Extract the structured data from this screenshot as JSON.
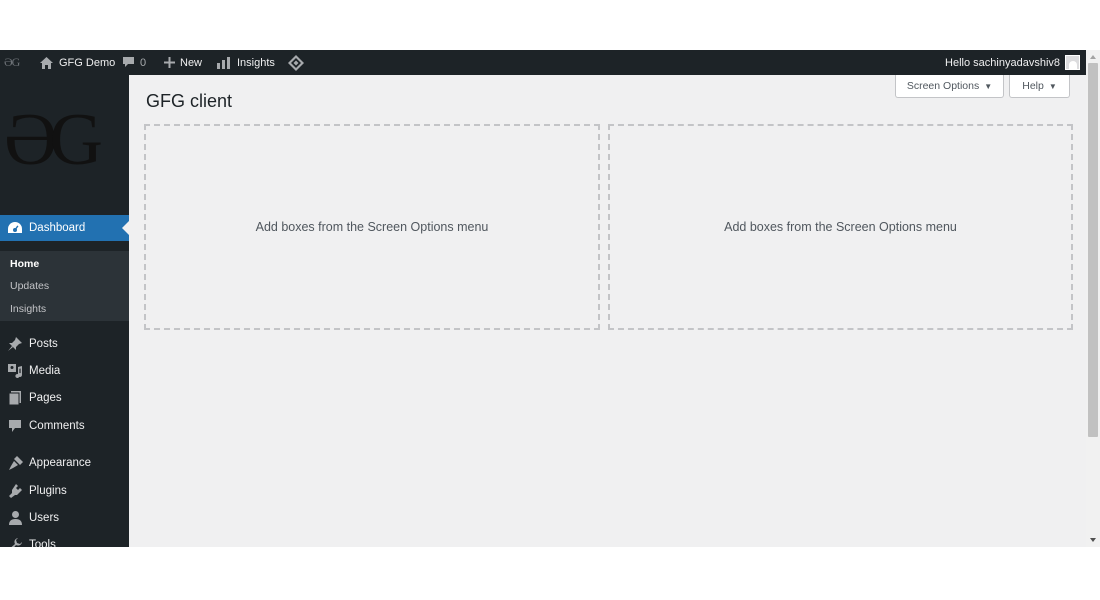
{
  "admin_bar": {
    "logo_text": "ƏG",
    "site_name": "GFG Demo",
    "comments_count": "0",
    "new_label": "New",
    "insights_label": "Insights",
    "account_greeting": "Hello sachinyadavshiv8"
  },
  "sidebar": {
    "logo_text": "ƏG",
    "current_menu": {
      "label": "Dashboard",
      "icon": "dashboard-icon"
    },
    "submenu": [
      {
        "label": "Home",
        "active": true
      },
      {
        "label": "Updates",
        "active": false
      },
      {
        "label": "Insights",
        "active": false
      }
    ],
    "menu_items": [
      {
        "label": "Posts",
        "icon": "pin-icon"
      },
      {
        "label": "Media",
        "icon": "media-icon"
      },
      {
        "label": "Pages",
        "icon": "pages-icon"
      },
      {
        "label": "Comments",
        "icon": "comments-icon"
      },
      {
        "label": "Appearance",
        "icon": "appearance-icon"
      },
      {
        "label": "Plugins",
        "icon": "plugins-icon"
      },
      {
        "label": "Users",
        "icon": "users-icon"
      },
      {
        "label": "Tools",
        "icon": "tools-icon"
      }
    ]
  },
  "main": {
    "page_title": "GFG client",
    "screen_options_label": "Screen Options",
    "help_label": "Help",
    "boxes": [
      {
        "placeholder": "Add boxes from the Screen Options menu"
      },
      {
        "placeholder": "Add boxes from the Screen Options menu"
      }
    ]
  },
  "colors": {
    "admin_bar_bg": "#1d2327",
    "accent": "#2271b1",
    "content_bg": "#f0f0f1"
  }
}
